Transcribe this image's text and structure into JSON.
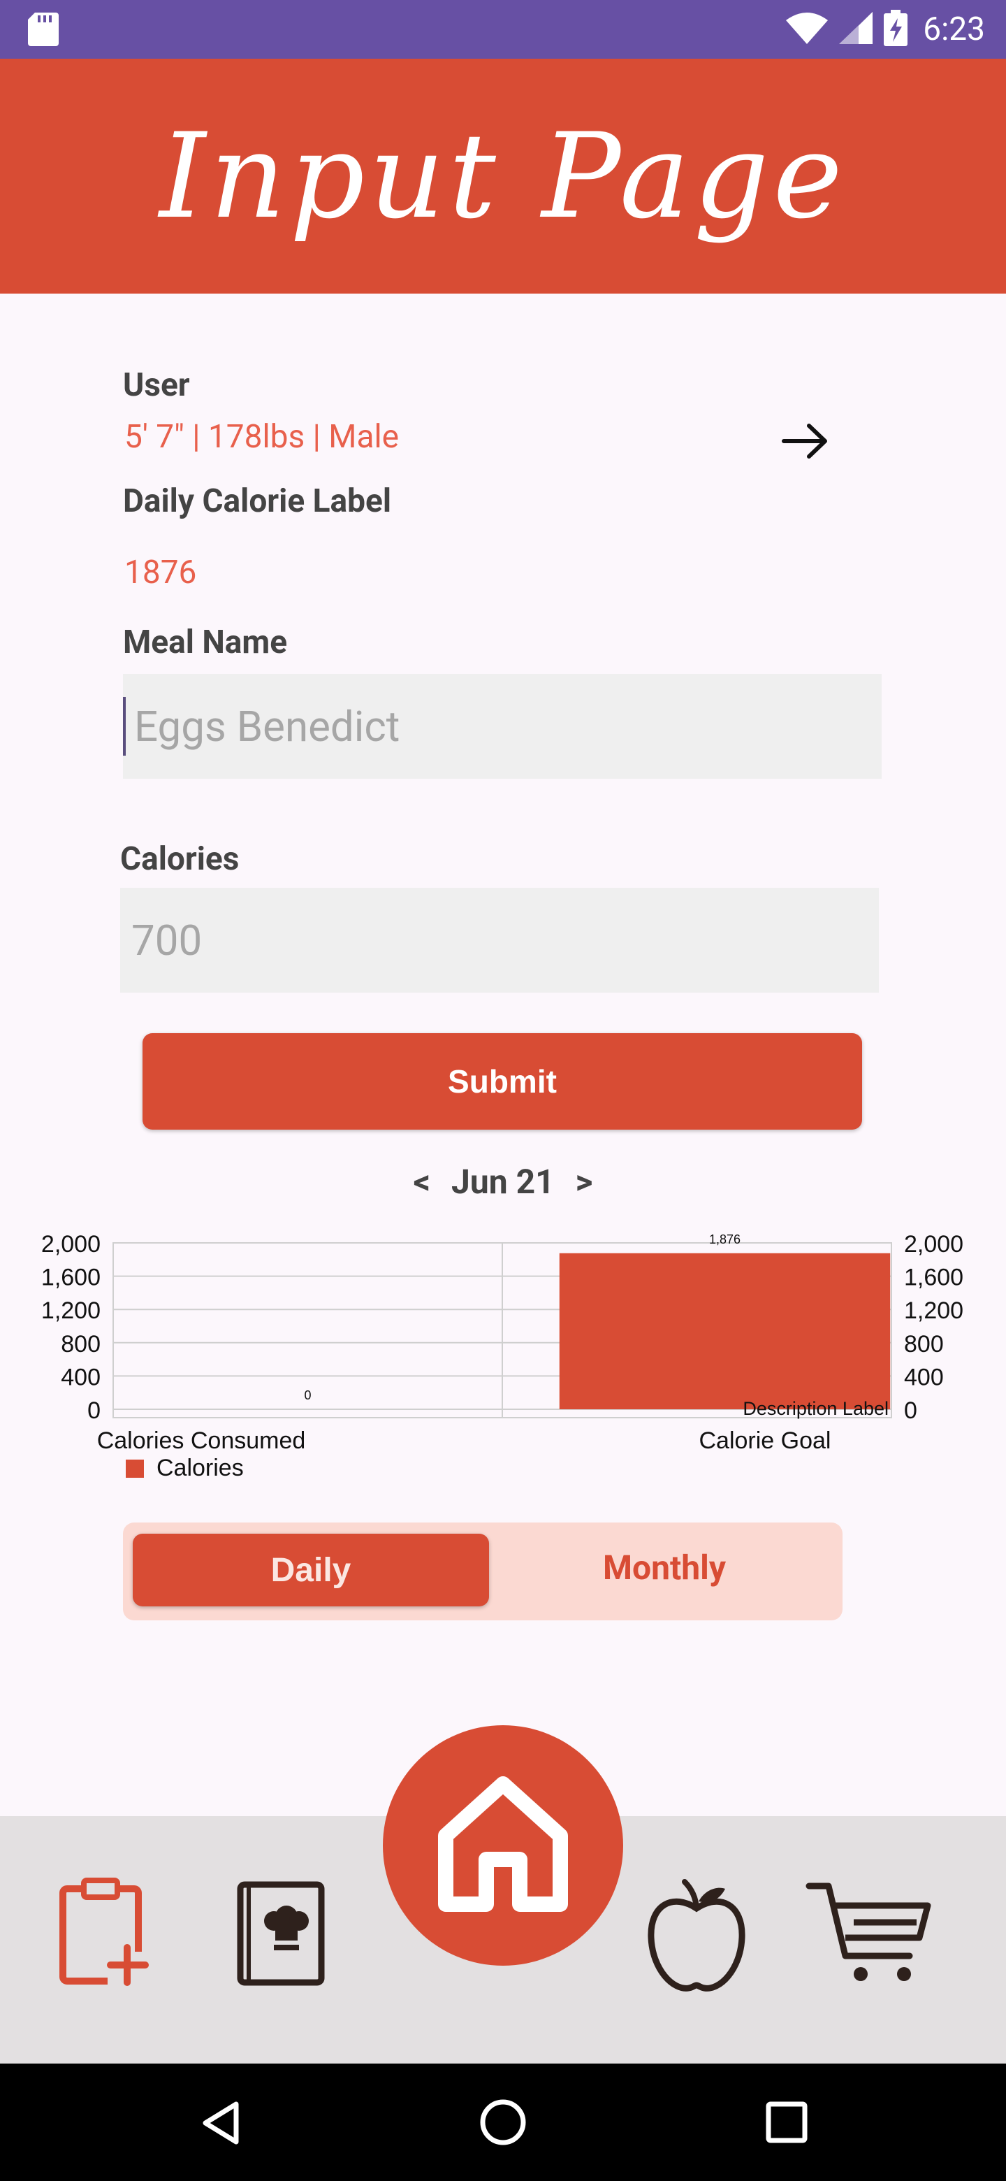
{
  "status_bar": {
    "time": "6:23"
  },
  "header": {
    "title": "Input Page"
  },
  "user": {
    "label": "User",
    "value": "5' 7\" | 178lbs | Male"
  },
  "daily_calorie": {
    "label": "Daily Calorie Label",
    "value": "1876"
  },
  "meal_name": {
    "label": "Meal Name",
    "placeholder": "Eggs Benedict"
  },
  "calories": {
    "label": "Calories",
    "placeholder": "700"
  },
  "submit": {
    "label": "Submit"
  },
  "date_nav": {
    "prev": "<",
    "date": "Jun 21",
    "next": ">"
  },
  "chart_data": {
    "type": "bar",
    "categories": [
      "Calories Consumed",
      "Calorie Goal"
    ],
    "series": [
      {
        "name": "Calories",
        "values": [
          0,
          1876
        ],
        "value_labels": [
          "0",
          "1,876"
        ]
      }
    ],
    "ylim": [
      0,
      2000
    ],
    "yticks": [
      "0",
      "400",
      "800",
      "1,200",
      "1,600",
      "2,000"
    ],
    "description": "Description Label",
    "grid": true,
    "legend_position": "bottom-left",
    "bar_color": "#D84C34"
  },
  "toggle": {
    "daily": "Daily",
    "monthly": "Monthly"
  },
  "bottom_nav": {
    "items": [
      "add-meal-icon",
      "recipe-book-icon",
      "home-icon",
      "apple-icon",
      "cart-icon"
    ]
  },
  "colors": {
    "accent": "#D84C34",
    "status_bar": "#6750A4",
    "value_text": "#E8604C"
  }
}
